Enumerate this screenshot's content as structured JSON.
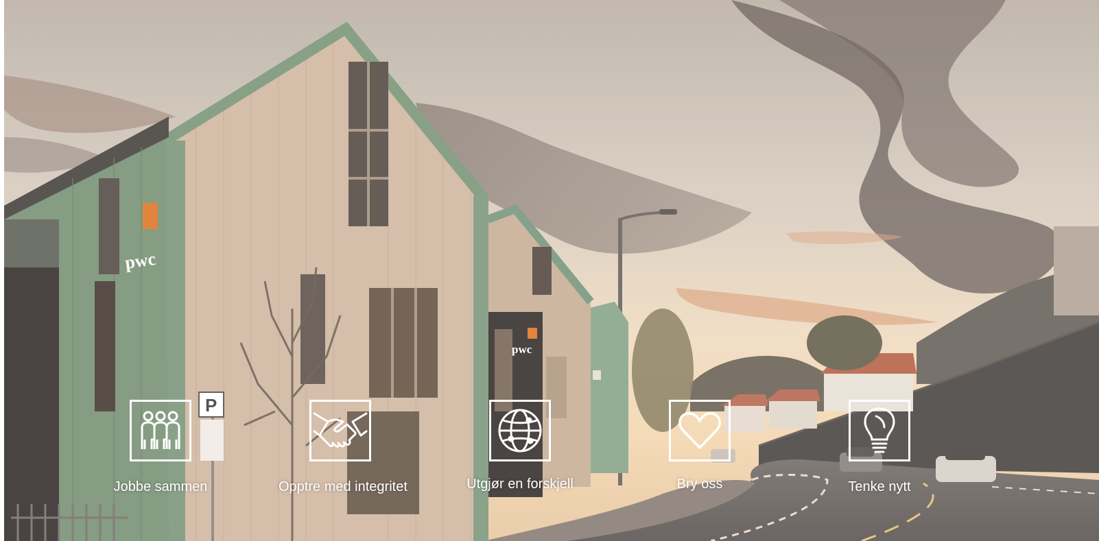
{
  "building_signs": [
    "pwc",
    "pwc"
  ],
  "parking_sign": "P",
  "values": [
    {
      "label": "Jobbe sammen",
      "icon": "people-group-icon"
    },
    {
      "label": "Opptre med integritet",
      "icon": "handshake-icon"
    },
    {
      "label": "Utgjør en forskjell",
      "icon": "globe-network-icon"
    },
    {
      "label": "Bry oss",
      "icon": "heart-icon"
    },
    {
      "label": "Tenke nytt",
      "icon": "lightbulb-icon"
    }
  ]
}
